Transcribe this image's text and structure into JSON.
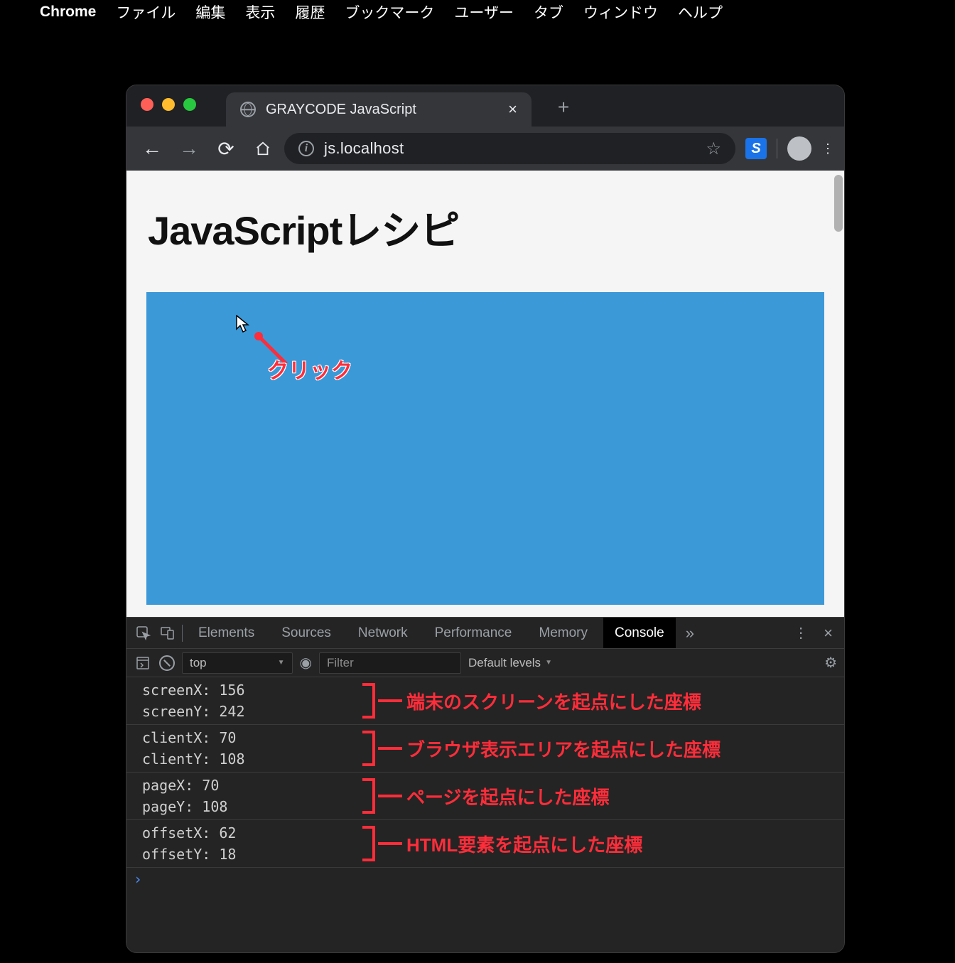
{
  "mac_menu": {
    "app": "Chrome",
    "items": [
      "ファイル",
      "編集",
      "表示",
      "履歴",
      "ブックマーク",
      "ユーザー",
      "タブ",
      "ウィンドウ",
      "ヘルプ"
    ]
  },
  "browser": {
    "tab_title": "GRAYCODE JavaScript",
    "url": "js.localhost"
  },
  "page": {
    "heading": "JavaScriptレシピ",
    "click_label": "クリック"
  },
  "devtools": {
    "tabs": [
      "Elements",
      "Sources",
      "Network",
      "Performance",
      "Memory",
      "Console"
    ],
    "active_tab": "Console",
    "context": "top",
    "filter_placeholder": "Filter",
    "levels": "Default levels",
    "rows": [
      {
        "l1": "screenX: 156",
        "l2": "screenY: 242",
        "annot": "端末のスクリーンを起点にした座標"
      },
      {
        "l1": "clientX: 70",
        "l2": "clientY: 108",
        "annot": "ブラウザ表示エリアを起点にした座標"
      },
      {
        "l1": "pageX: 70",
        "l2": "pageY: 108",
        "annot": "ページを起点にした座標"
      },
      {
        "l1": "offsetX: 62",
        "l2": "offsetY: 18",
        "annot": "HTML要素を起点にした座標"
      }
    ]
  }
}
